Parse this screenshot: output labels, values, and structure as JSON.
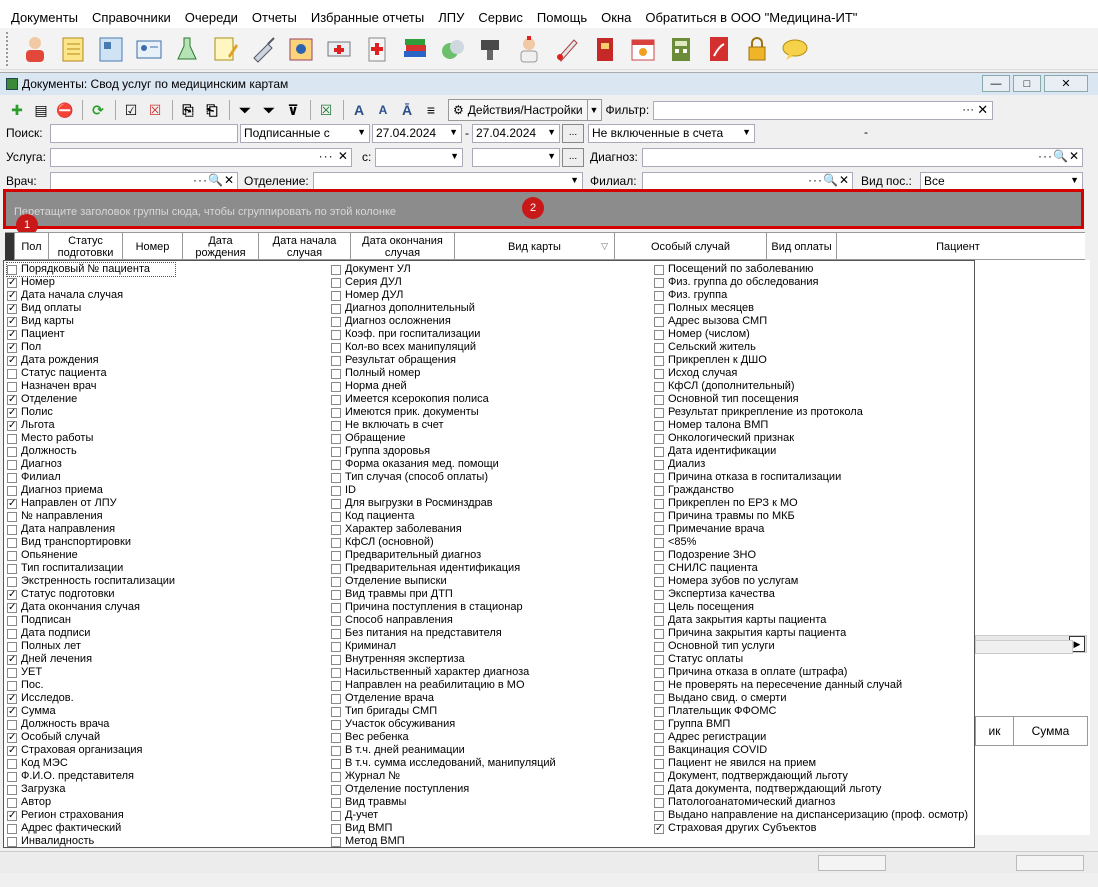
{
  "window_title": "Документы: Свод услуг по медицинским картам",
  "menu": [
    "Документы",
    "Справочники",
    "Очереди",
    "Отчеты",
    "Избранные отчеты",
    "ЛПУ",
    "Сервис",
    "Помощь",
    "Окна",
    "Обратиться в ООО \"Медицина-ИТ\""
  ],
  "toolbar_icons": [
    "doctor-icon",
    "notebook-icon",
    "card-icon",
    "id-card-icon",
    "lab-flask-icon",
    "edit-notes-icon",
    "syringe-icon",
    "reports-icon",
    "ambulance-icon",
    "first-aid-icon",
    "books-icon",
    "pills-icon",
    "scanner-icon",
    "nurse-icon",
    "thermometer-icon",
    "red-book-icon",
    "calendar-icon",
    "calculator-icon",
    "pdf-icon",
    "lock-icon",
    "chat-icon"
  ],
  "doc_toolbar": {
    "actions_label": "Действия/Настройки",
    "filter_label": "Фильтр:"
  },
  "filters": {
    "search_label": "Поиск:",
    "signed_select": "Подписанные с",
    "date_from": "27.04.2024",
    "date_to": "27.04.2024",
    "ellipsis": "...",
    "accounts_select": "Не включенные в счета",
    "dash": "-",
    "service_label": "Услуга:",
    "from_label": "с:",
    "diagnosis_label": "Диагноз:",
    "doctor_label": "Врач:",
    "department_label": "Отделение:",
    "branch_label": "Филиал:",
    "visit_type_label": "Вид пос.:",
    "visit_type_value": "Все"
  },
  "group_hint": "Перетащите заголовок группы сюда, чтобы сгруппировать по этой колонке",
  "badges": {
    "b1": "1",
    "b2": "2"
  },
  "columns": [
    "Пол",
    "Статус подготовки",
    "Номер",
    "Дата рождения",
    "Дата начала случая",
    "Дата окончания случая",
    "Вид карты",
    "Особый случай",
    "Вид оплаты",
    "Пациент"
  ],
  "grid2_columns": [
    "ик",
    "Сумма"
  ],
  "col1": [
    {
      "label": "Порядковый № пациента",
      "checked": false
    },
    {
      "label": "Номер",
      "checked": true
    },
    {
      "label": "Дата начала случая",
      "checked": true
    },
    {
      "label": "Вид оплаты",
      "checked": true
    },
    {
      "label": "Вид карты",
      "checked": true
    },
    {
      "label": "Пациент",
      "checked": true
    },
    {
      "label": "Пол",
      "checked": true
    },
    {
      "label": "Дата рождения",
      "checked": true
    },
    {
      "label": "Статус пациента",
      "checked": false
    },
    {
      "label": "Назначен врач",
      "checked": false
    },
    {
      "label": "Отделение",
      "checked": true
    },
    {
      "label": "Полис",
      "checked": true
    },
    {
      "label": "Льгота",
      "checked": true
    },
    {
      "label": "Место работы",
      "checked": false
    },
    {
      "label": "Должность",
      "checked": false
    },
    {
      "label": "Диагноз",
      "checked": false
    },
    {
      "label": "Филиал",
      "checked": false
    },
    {
      "label": "Диагноз приема",
      "checked": false
    },
    {
      "label": "Направлен от ЛПУ",
      "checked": true
    },
    {
      "label": "№ направления",
      "checked": false
    },
    {
      "label": "Дата направления",
      "checked": false
    },
    {
      "label": "Вид транспортировки",
      "checked": false
    },
    {
      "label": "Опьянение",
      "checked": false
    },
    {
      "label": "Тип госпитализации",
      "checked": false
    },
    {
      "label": "Экстренность госпитализации",
      "checked": false
    },
    {
      "label": "Статус подготовки",
      "checked": true
    },
    {
      "label": "Дата окончания случая",
      "checked": true
    },
    {
      "label": "Подписан",
      "checked": false
    },
    {
      "label": "Дата подписи",
      "checked": false
    },
    {
      "label": "Полных лет",
      "checked": false
    },
    {
      "label": "Дней лечения",
      "checked": true
    },
    {
      "label": "УЕТ",
      "checked": false
    },
    {
      "label": "Пос.",
      "checked": false
    },
    {
      "label": "Исследов.",
      "checked": true
    },
    {
      "label": "Сумма",
      "checked": true
    },
    {
      "label": "Должность врача",
      "checked": false
    },
    {
      "label": "Особый случай",
      "checked": true
    },
    {
      "label": "Страховая организация",
      "checked": true
    },
    {
      "label": "Код МЭС",
      "checked": false
    },
    {
      "label": "Ф.И.О. представителя",
      "checked": false
    },
    {
      "label": "Загрузка",
      "checked": false
    },
    {
      "label": "Автор",
      "checked": false
    },
    {
      "label": "Регион страхования",
      "checked": true
    },
    {
      "label": "Адрес фактический",
      "checked": false
    },
    {
      "label": "Инвалидность",
      "checked": false
    }
  ],
  "col2": [
    {
      "label": "Документ УЛ",
      "checked": false
    },
    {
      "label": "Серия ДУЛ",
      "checked": false
    },
    {
      "label": "Номер ДУЛ",
      "checked": false
    },
    {
      "label": "Диагноз дополнительный",
      "checked": false
    },
    {
      "label": "Диагноз осложнения",
      "checked": false
    },
    {
      "label": "Коэф. при госпитализации",
      "checked": false
    },
    {
      "label": "Кол-во всех манипуляций",
      "checked": false
    },
    {
      "label": "Результат обращения",
      "checked": false
    },
    {
      "label": "Полный номер",
      "checked": false
    },
    {
      "label": "Норма дней",
      "checked": false
    },
    {
      "label": "Имеется ксерокопия полиса",
      "checked": false
    },
    {
      "label": "Имеются прик. документы",
      "checked": false
    },
    {
      "label": "Не включать в счет",
      "checked": false
    },
    {
      "label": "Обращение",
      "checked": false
    },
    {
      "label": "Группа здоровья",
      "checked": false
    },
    {
      "label": "Форма оказания мед. помощи",
      "checked": false
    },
    {
      "label": "Тип случая (способ оплаты)",
      "checked": false
    },
    {
      "label": "ID",
      "checked": false
    },
    {
      "label": "Для выгрузки в Росминздрав",
      "checked": false
    },
    {
      "label": "Код пациента",
      "checked": false
    },
    {
      "label": "Характер заболевания",
      "checked": false
    },
    {
      "label": "КфСЛ (основной)",
      "checked": false
    },
    {
      "label": "Предварительный диагноз",
      "checked": false
    },
    {
      "label": "Предварительная идентификация",
      "checked": false
    },
    {
      "label": "Отделение выписки",
      "checked": false
    },
    {
      "label": "Вид травмы при ДТП",
      "checked": false
    },
    {
      "label": "Причина поступления в стационар",
      "checked": false
    },
    {
      "label": "Способ направления",
      "checked": false
    },
    {
      "label": "Без питания на представителя",
      "checked": false
    },
    {
      "label": "Криминал",
      "checked": false
    },
    {
      "label": "Внутренняя экспертиза",
      "checked": false
    },
    {
      "label": "Насильственный характер диагноза",
      "checked": false
    },
    {
      "label": "Направлен на реабилитацию в МО",
      "checked": false
    },
    {
      "label": "Отделение врача",
      "checked": false
    },
    {
      "label": "Тип бригады СМП",
      "checked": false
    },
    {
      "label": "Участок обсуживания",
      "checked": false
    },
    {
      "label": "Вес ребенка",
      "checked": false
    },
    {
      "label": "В т.ч. дней реанимации",
      "checked": false
    },
    {
      "label": "В т.ч. сумма исследований, манипуляций",
      "checked": false
    },
    {
      "label": "Журнал №",
      "checked": false
    },
    {
      "label": "Отделение поступления",
      "checked": false
    },
    {
      "label": "Вид травмы",
      "checked": false
    },
    {
      "label": "Д-учет",
      "checked": false
    },
    {
      "label": "Вид ВМП",
      "checked": false
    },
    {
      "label": "Метод ВМП",
      "checked": false
    }
  ],
  "col3": [
    {
      "label": "Посещений по заболеванию",
      "checked": false
    },
    {
      "label": "Физ. группа до обследования",
      "checked": false
    },
    {
      "label": "Физ. группа",
      "checked": false
    },
    {
      "label": "Полных месяцев",
      "checked": false
    },
    {
      "label": "Адрес вызова СМП",
      "checked": false
    },
    {
      "label": "Номер (числом)",
      "checked": false
    },
    {
      "label": "Сельский житель",
      "checked": false
    },
    {
      "label": "Прикреплен к ДШО",
      "checked": false
    },
    {
      "label": "Исход случая",
      "checked": false
    },
    {
      "label": "КфСЛ (дополнительный)",
      "checked": false
    },
    {
      "label": "Основной тип посещения",
      "checked": false
    },
    {
      "label": "Результат прикрепление из протокола",
      "checked": false
    },
    {
      "label": "Номер талона ВМП",
      "checked": false
    },
    {
      "label": "Онкологический признак",
      "checked": false
    },
    {
      "label": "Дата идентификации",
      "checked": false
    },
    {
      "label": "Диализ",
      "checked": false
    },
    {
      "label": "Причина отказа в госпитализации",
      "checked": false
    },
    {
      "label": "Гражданство",
      "checked": false
    },
    {
      "label": "Прикреплен по ЕРЗ к МО",
      "checked": false
    },
    {
      "label": "Причина травмы по МКБ",
      "checked": false
    },
    {
      "label": "Примечание врача",
      "checked": false
    },
    {
      "label": "<85%",
      "checked": false
    },
    {
      "label": "Подозрение ЗНО",
      "checked": false
    },
    {
      "label": "СНИЛС пациента",
      "checked": false
    },
    {
      "label": "Номера зубов по услугам",
      "checked": false
    },
    {
      "label": "Экспертиза качества",
      "checked": false
    },
    {
      "label": "Цель посещения",
      "checked": false
    },
    {
      "label": "Дата закрытия карты пациента",
      "checked": false
    },
    {
      "label": "Причина закрытия карты пациента",
      "checked": false
    },
    {
      "label": "Основной тип услуги",
      "checked": false
    },
    {
      "label": "Статус оплаты",
      "checked": false
    },
    {
      "label": "Причина отказа в оплате (штрафа)",
      "checked": false
    },
    {
      "label": "Не проверять на пересечение данный случай",
      "checked": false
    },
    {
      "label": "Выдано свид. о смерти",
      "checked": false
    },
    {
      "label": "Плательщик ФФОМС",
      "checked": false
    },
    {
      "label": "Группа ВМП",
      "checked": false
    },
    {
      "label": "Адрес регистрации",
      "checked": false
    },
    {
      "label": "Вакцинация COVID",
      "checked": false
    },
    {
      "label": "Пациент не явился на прием",
      "checked": false
    },
    {
      "label": "Документ, подтверждающий льготу",
      "checked": false
    },
    {
      "label": "Дата документа, подтверждающий льготу",
      "checked": false
    },
    {
      "label": "Патологоанатомический диагноз",
      "checked": false
    },
    {
      "label": "Выдано направление на диспансеризацию (проф. осмотр)",
      "checked": false
    },
    {
      "label": "Страховая других Субъектов",
      "checked": true
    }
  ]
}
